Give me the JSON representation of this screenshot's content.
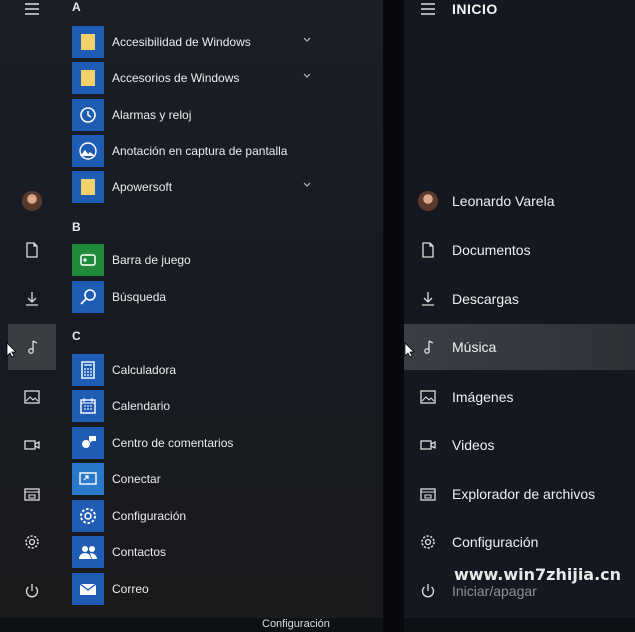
{
  "left_menu": {
    "rail": [
      {
        "icon": "hamburger-icon"
      },
      {
        "icon": "avatar-icon"
      },
      {
        "icon": "document-icon"
      },
      {
        "icon": "download-icon"
      },
      {
        "icon": "music-icon",
        "active": true
      },
      {
        "icon": "image-icon"
      },
      {
        "icon": "video-icon"
      },
      {
        "icon": "file-explorer-icon"
      },
      {
        "icon": "gear-icon"
      },
      {
        "icon": "power-icon"
      }
    ],
    "letters": [
      "A",
      "B",
      "C"
    ],
    "apps": [
      {
        "label": "Accesibilidad de Windows",
        "icon": "folder-icon",
        "expandable": true
      },
      {
        "label": "Accesorios de Windows",
        "icon": "folder-icon",
        "expandable": true
      },
      {
        "label": "Alarmas y reloj",
        "icon": "clock-icon"
      },
      {
        "label": "Anotación en captura de pantalla",
        "icon": "snip-icon"
      },
      {
        "label": "Apowersoft",
        "icon": "folder-icon",
        "expandable": true
      },
      {
        "label": "Barra de juego",
        "icon": "gamebar-icon"
      },
      {
        "label": "Búsqueda",
        "icon": "search-icon"
      },
      {
        "label": "Calculadora",
        "icon": "calculator-icon"
      },
      {
        "label": "Calendario",
        "icon": "calendar-icon"
      },
      {
        "label": "Centro de comentarios",
        "icon": "feedback-icon"
      },
      {
        "label": "Conectar",
        "icon": "connect-icon"
      },
      {
        "label": "Configuración",
        "icon": "gear-icon"
      },
      {
        "label": "Contactos",
        "icon": "people-icon"
      },
      {
        "label": "Correo",
        "icon": "mail-icon"
      }
    ],
    "taskbar_label": "Configuración"
  },
  "right_menu": {
    "title": "INICIO",
    "items": [
      {
        "label": "Leonardo Varela",
        "icon": "avatar-icon"
      },
      {
        "label": "Documentos",
        "icon": "document-icon"
      },
      {
        "label": "Descargas",
        "icon": "download-icon"
      },
      {
        "label": "Música",
        "icon": "music-icon",
        "active": true
      },
      {
        "label": "Imágenes",
        "icon": "image-icon"
      },
      {
        "label": "Videos",
        "icon": "video-icon"
      },
      {
        "label": "Explorador de archivos",
        "icon": "file-explorer-icon"
      },
      {
        "label": "Configuración",
        "icon": "gear-icon"
      }
    ],
    "partial_item": "Iniciar/apagar",
    "watermark": "www.win7zhijia.cn"
  },
  "colors": {
    "tile_blue": "#1f5cb4",
    "tile_green": "#1e8a3a",
    "highlight": "#3a3d42"
  }
}
